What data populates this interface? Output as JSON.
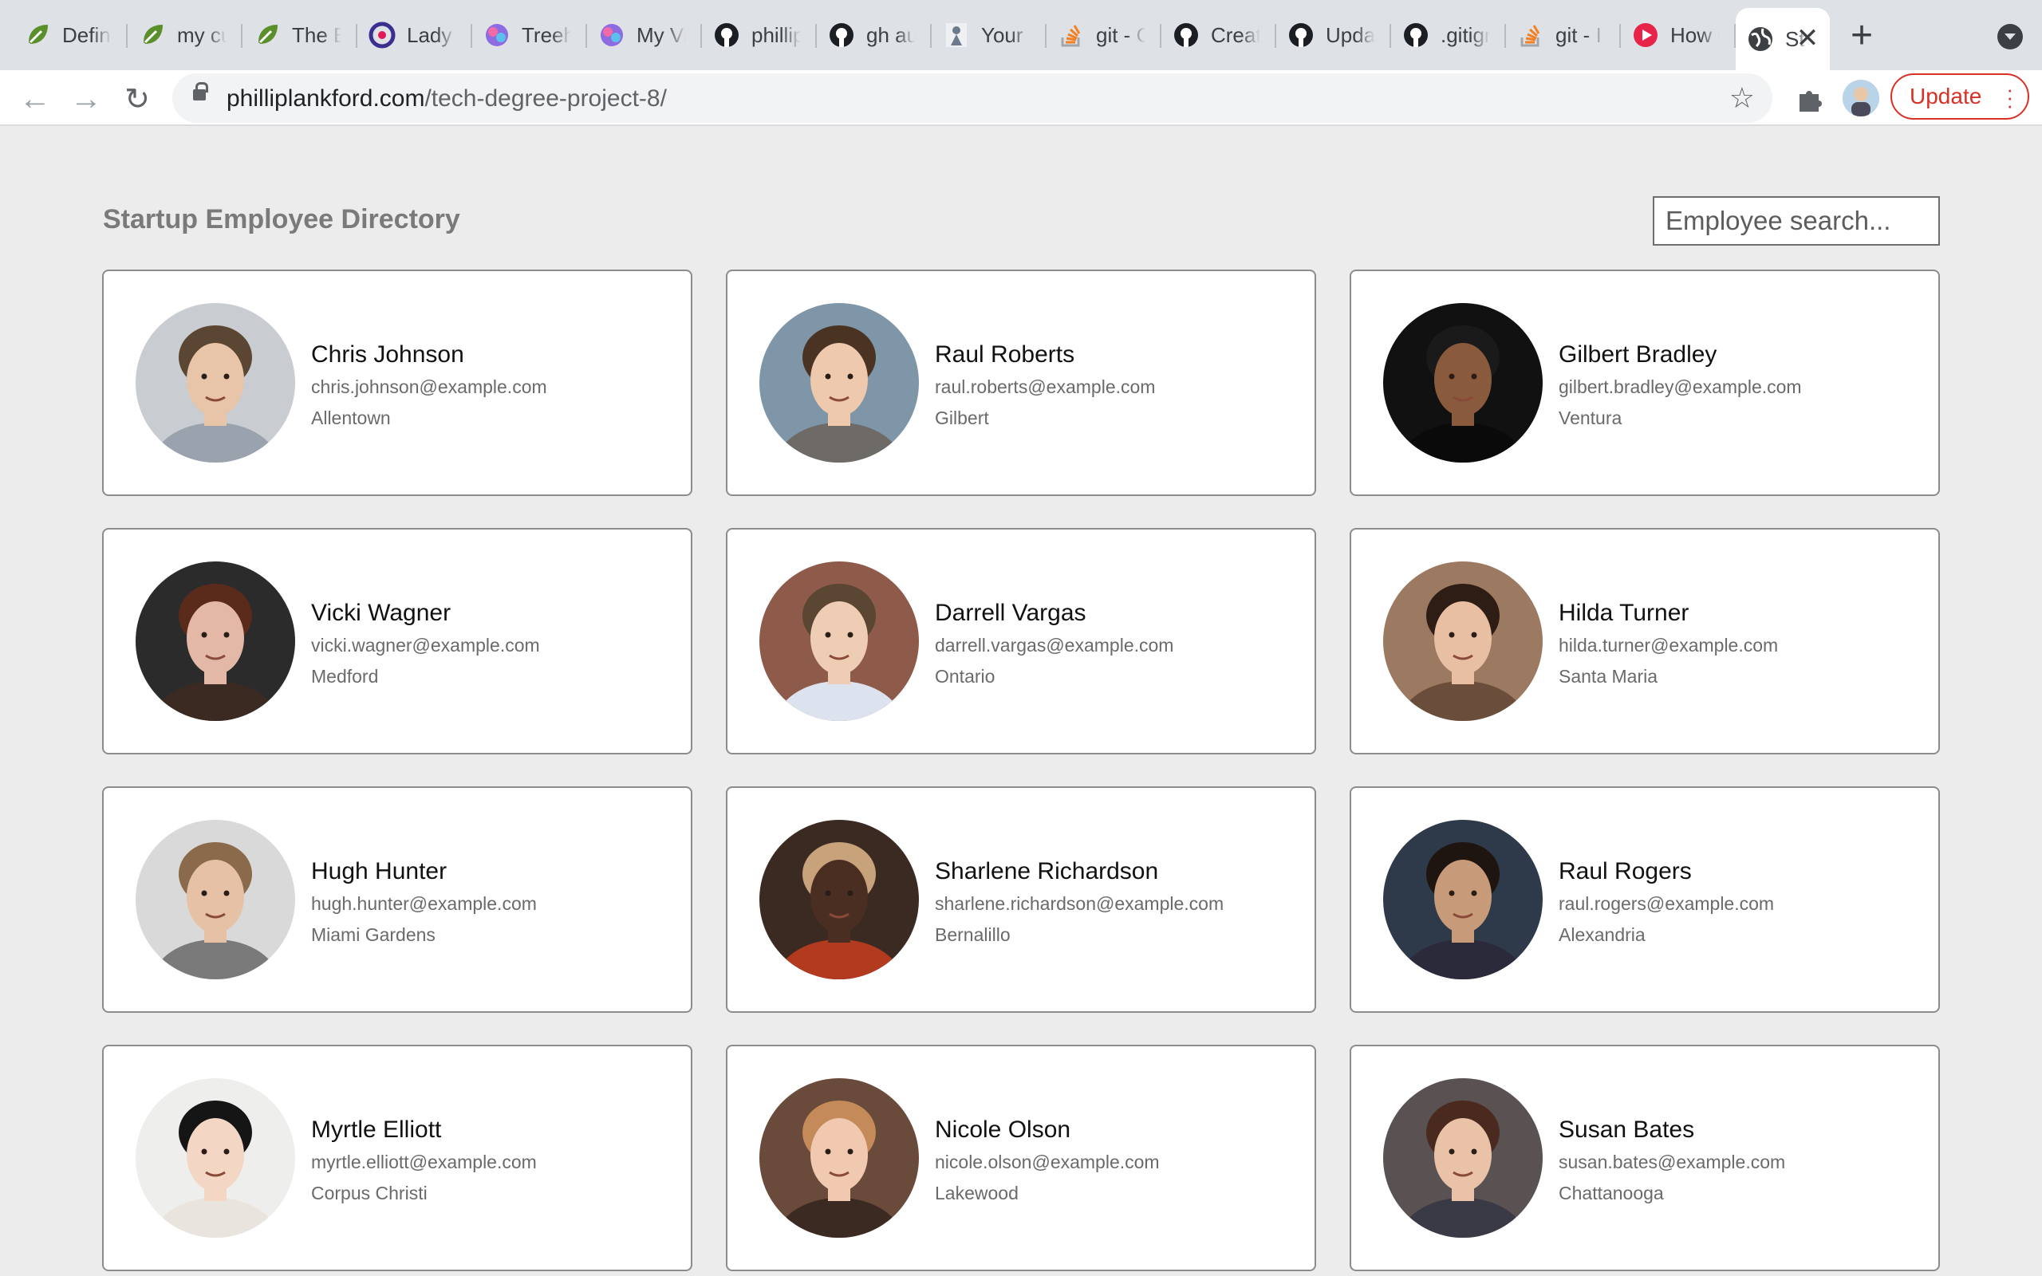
{
  "browser": {
    "tabs": [
      {
        "label": "Defini",
        "icon": "leaf-icon",
        "color": "#5a8f29"
      },
      {
        "label": "my cu",
        "icon": "leaf-icon",
        "color": "#5a8f29"
      },
      {
        "label": "The B",
        "icon": "leaf-icon",
        "color": "#5a8f29"
      },
      {
        "label": "Lady",
        "icon": "circle-c-icon",
        "color": "#3b2f8f"
      },
      {
        "label": "Treeh",
        "icon": "treehouse-icon",
        "color": "#8d6be0"
      },
      {
        "label": "My Vi",
        "icon": "treehouse-icon",
        "color": "#8d6be0"
      },
      {
        "label": "phillip",
        "icon": "github-icon",
        "color": "#1b1f23"
      },
      {
        "label": "gh au",
        "icon": "github-icon",
        "color": "#1b1f23"
      },
      {
        "label": "Your",
        "icon": "figure-icon",
        "color": "#6b7a8c"
      },
      {
        "label": "git - C",
        "icon": "stackoverflow-icon",
        "color": "#f48024"
      },
      {
        "label": "Creat",
        "icon": "github-icon",
        "color": "#1b1f23"
      },
      {
        "label": "Upda",
        "icon": "github-icon",
        "color": "#1b1f23"
      },
      {
        "label": ".gitign",
        "icon": "github-icon",
        "color": "#1b1f23"
      },
      {
        "label": "git - I",
        "icon": "stackoverflow-icon",
        "color": "#f48024"
      },
      {
        "label": "How t",
        "icon": "play-icon",
        "color": "#e8234a"
      }
    ],
    "active_tab": {
      "label": "St",
      "icon": "globe-icon"
    },
    "url_host": "philliplankford.com",
    "url_path": "/tech-degree-project-8/",
    "update_label": "Update"
  },
  "page": {
    "title": "Startup Employee Directory",
    "search_placeholder": "Employee search..."
  },
  "employees": [
    {
      "name": "Chris Johnson",
      "email": "chris.johnson@example.com",
      "city": "Allentown",
      "skin": "#e8c4a8",
      "hair": "#5a4632",
      "bg": "#c9ccd1",
      "shirt": "#9aa3ad"
    },
    {
      "name": "Raul Roberts",
      "email": "raul.roberts@example.com",
      "city": "Gilbert",
      "skin": "#eec9ad",
      "hair": "#4a3322",
      "bg": "#7f95a8",
      "shirt": "#6e6a66"
    },
    {
      "name": "Gilbert Bradley",
      "email": "gilbert.bradley@example.com",
      "city": "Ventura",
      "skin": "#8a5a3c",
      "hair": "#1a1a1a",
      "bg": "#111111",
      "shirt": "#0a0a0a"
    },
    {
      "name": "Vicki Wagner",
      "email": "vicki.wagner@example.com",
      "city": "Medford",
      "skin": "#e3b8a6",
      "hair": "#5a2a1a",
      "bg": "#2b2b2b",
      "shirt": "#3a2a22"
    },
    {
      "name": "Darrell Vargas",
      "email": "darrell.vargas@example.com",
      "city": "Ontario",
      "skin": "#efcdb4",
      "hair": "#5b4533",
      "bg": "#8e5a4a",
      "shirt": "#dde3ee"
    },
    {
      "name": "Hilda Turner",
      "email": "hilda.turner@example.com",
      "city": "Santa Maria",
      "skin": "#e9bfa3",
      "hair": "#2e1d14",
      "bg": "#9c7a62",
      "shirt": "#6b4d3b"
    },
    {
      "name": "Hugh Hunter",
      "email": "hugh.hunter@example.com",
      "city": "Miami Gardens",
      "skin": "#e6c1a5",
      "hair": "#8a6a4a",
      "bg": "#d9d9d9",
      "shirt": "#7a7a7a"
    },
    {
      "name": "Sharlene Richardson",
      "email": "sharlene.richardson@example.com",
      "city": "Bernalillo",
      "skin": "#4a2e22",
      "hair": "#c7a27a",
      "bg": "#3a2a22",
      "shirt": "#b23a1e"
    },
    {
      "name": "Raul Rogers",
      "email": "raul.rogers@example.com",
      "city": "Alexandria",
      "skin": "#c79a7a",
      "hair": "#1e1410",
      "bg": "#2e3a4a",
      "shirt": "#2a2a3a"
    },
    {
      "name": "Myrtle Elliott",
      "email": "myrtle.elliott@example.com",
      "city": "Corpus Christi",
      "skin": "#f3d6c4",
      "hair": "#151515",
      "bg": "#eeeeec",
      "shirt": "#e9e4de"
    },
    {
      "name": "Nicole Olson",
      "email": "nicole.olson@example.com",
      "city": "Lakewood",
      "skin": "#f0c9b0",
      "hair": "#c48a5a",
      "bg": "#6a4a3a",
      "shirt": "#3a2a22"
    },
    {
      "name": "Susan Bates",
      "email": "susan.bates@example.com",
      "city": "Chattanooga",
      "skin": "#e9c2a8",
      "hair": "#4a2a1e",
      "bg": "#5a5252",
      "shirt": "#3a3a46"
    }
  ]
}
